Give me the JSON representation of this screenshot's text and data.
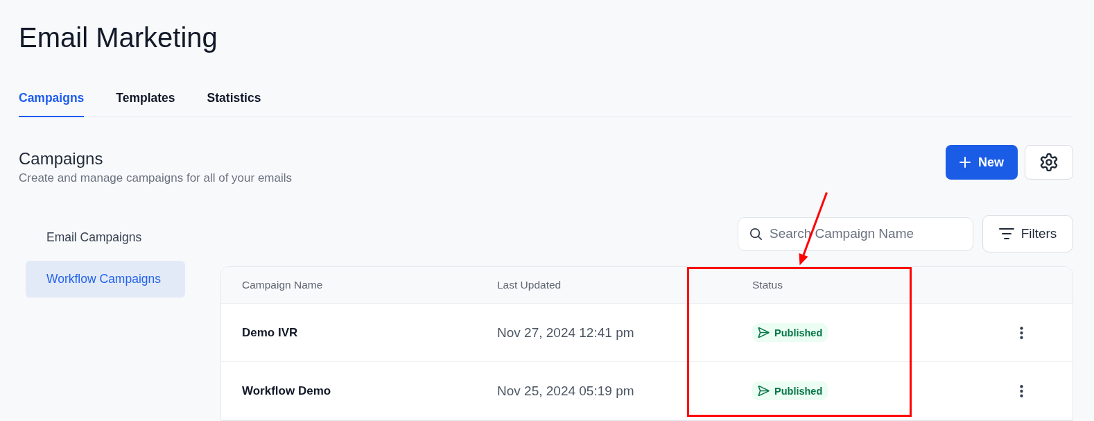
{
  "page": {
    "title": "Email Marketing"
  },
  "tabs": [
    {
      "label": "Campaigns",
      "selected": true
    },
    {
      "label": "Templates",
      "selected": false
    },
    {
      "label": "Statistics",
      "selected": false
    }
  ],
  "section": {
    "title": "Campaigns",
    "subtitle": "Create and manage campaigns for all of your emails",
    "new_button": "New"
  },
  "sidebar": {
    "items": [
      {
        "label": "Email Campaigns",
        "selected": false
      },
      {
        "label": "Workflow Campaigns",
        "selected": true
      }
    ]
  },
  "search": {
    "placeholder": "Search Campaign Name"
  },
  "filters_button": "Filters",
  "table": {
    "columns": [
      "Campaign Name",
      "Last Updated",
      "Status"
    ],
    "rows": [
      {
        "name": "Demo IVR",
        "last_updated": "Nov 27, 2024 12:41 pm",
        "status": {
          "label": "Published",
          "kind": "published"
        }
      },
      {
        "name": "Workflow Demo",
        "last_updated": "Nov 25, 2024 05:19 pm",
        "status": {
          "label": "Published",
          "kind": "published"
        }
      }
    ]
  },
  "annotation": {
    "arrow": true,
    "highlight_frame": true
  }
}
